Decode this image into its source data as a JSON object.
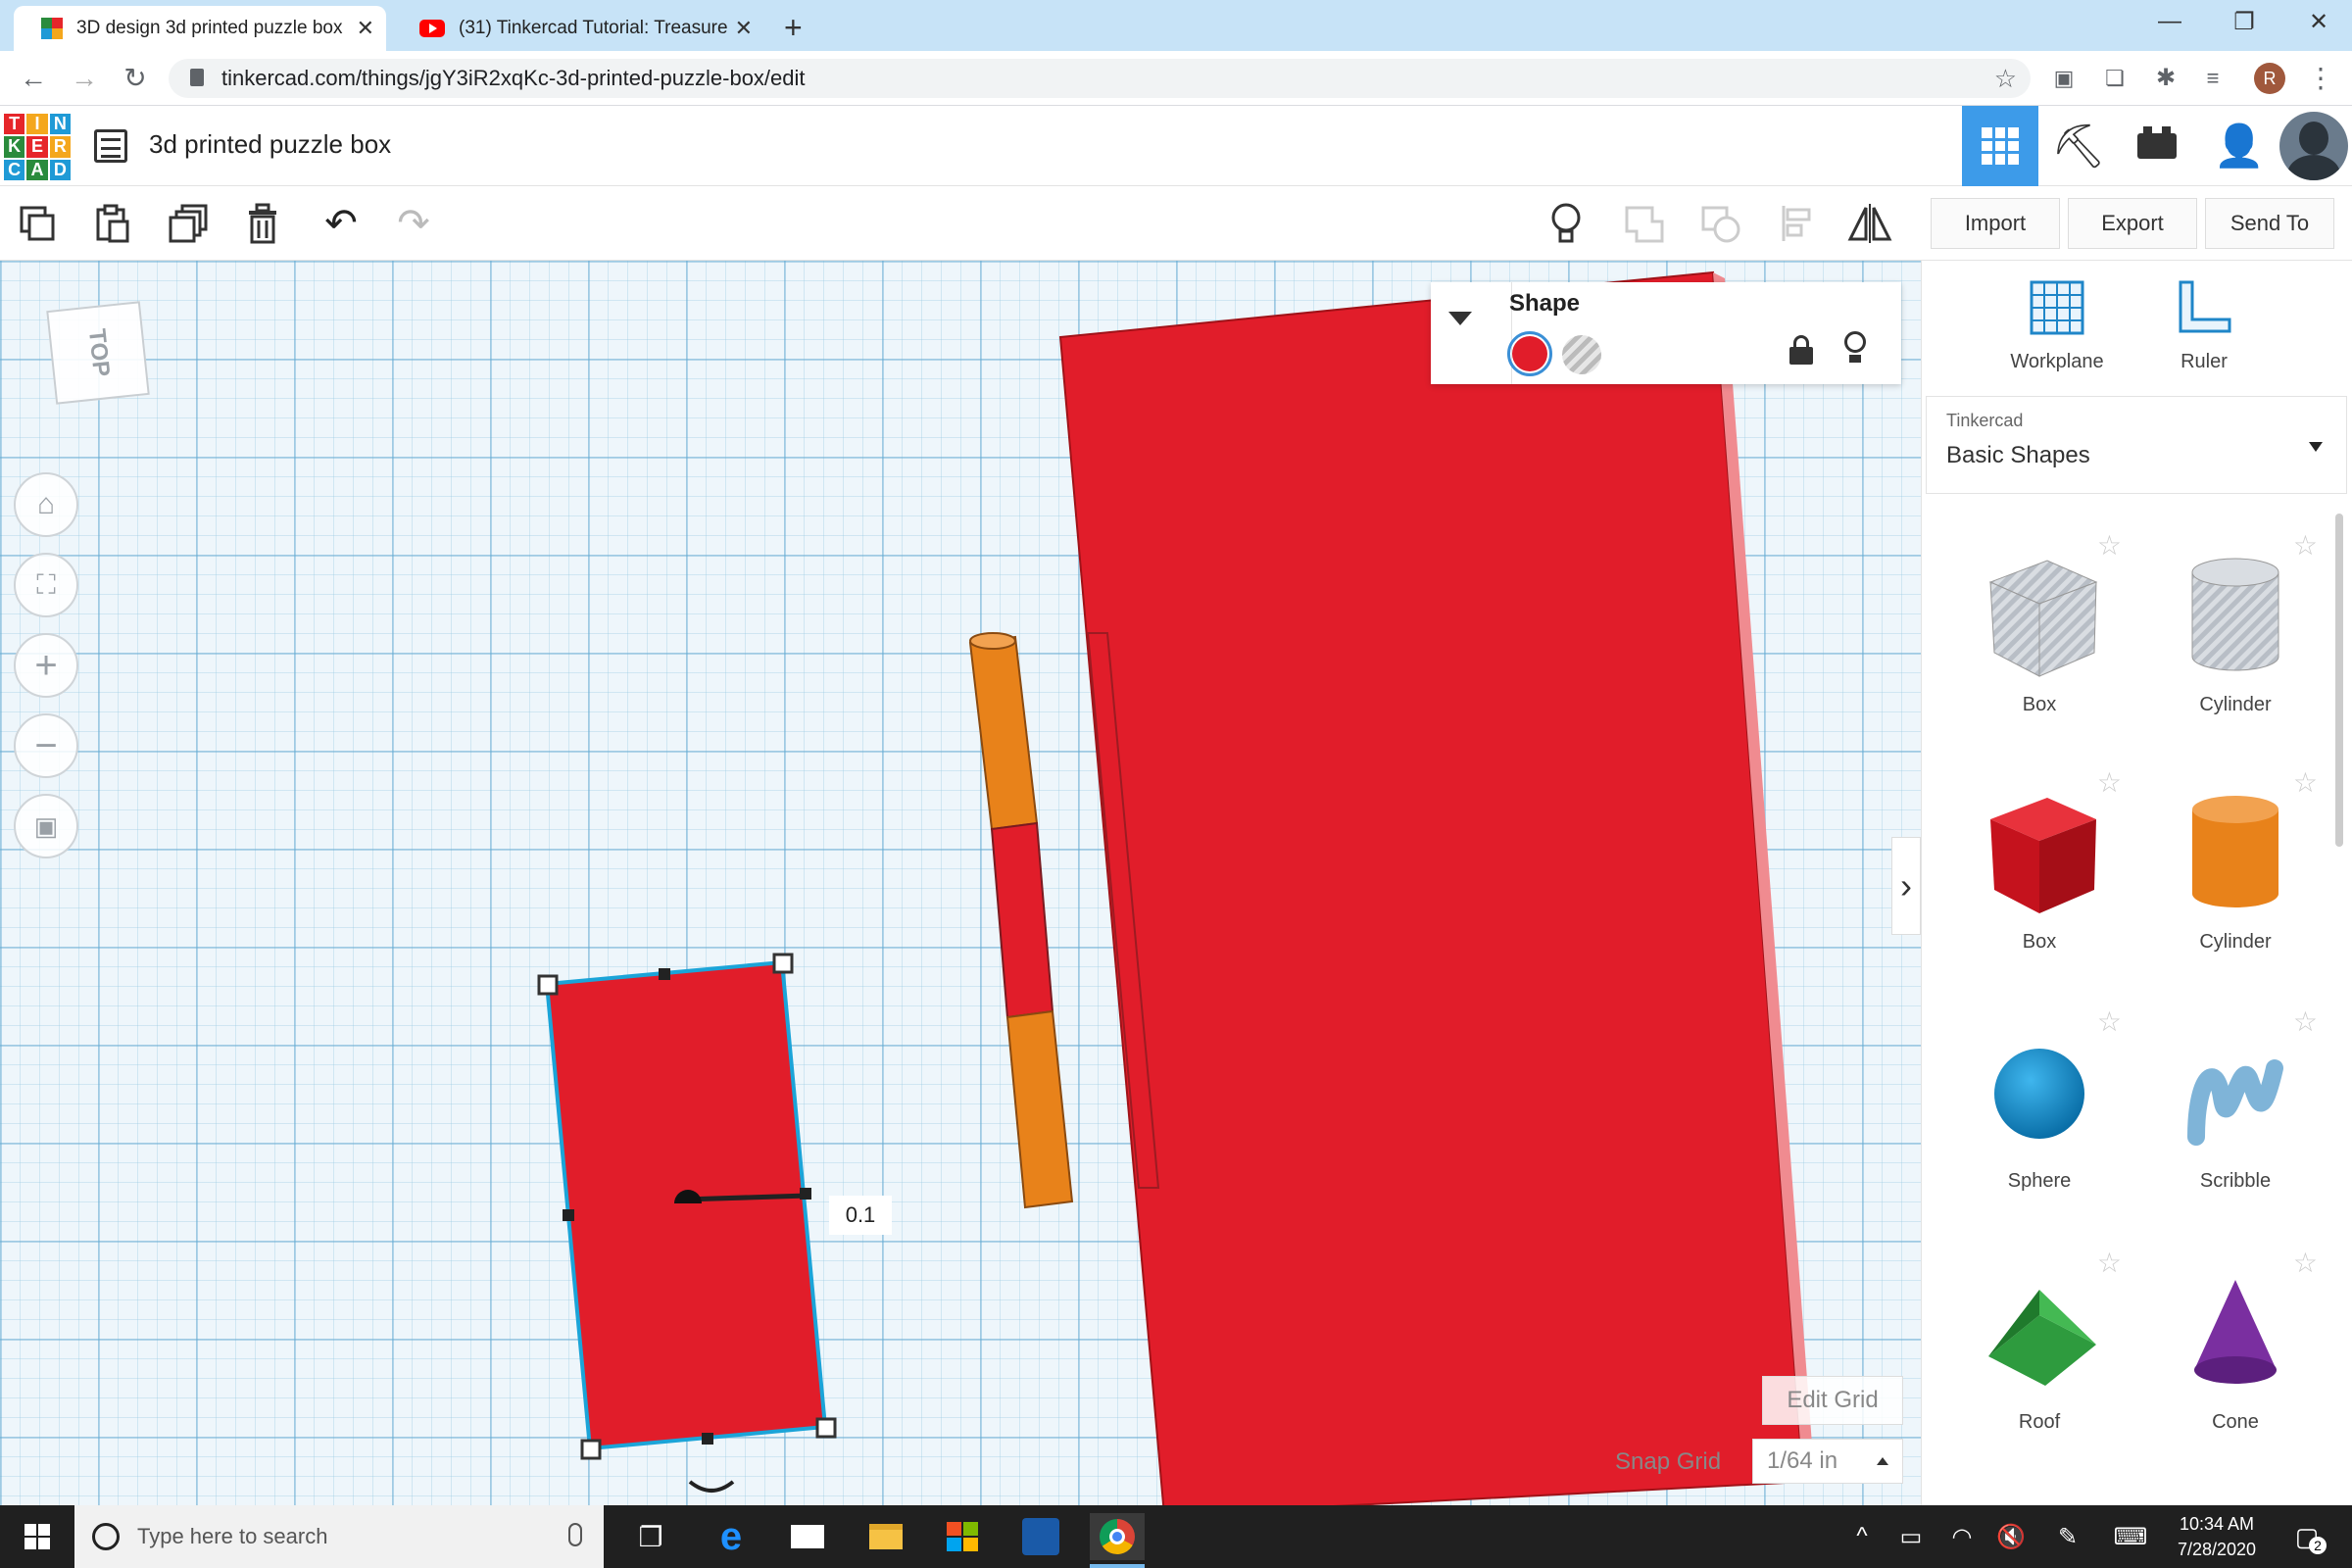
{
  "browser": {
    "tabs": [
      {
        "label": "3D design 3d printed puzzle box"
      },
      {
        "label": "(31) Tinkercad Tutorial: Treasure"
      }
    ],
    "url": "tinkercad.com/things/jgY3iR2xqKc-3d-printed-puzzle-box/edit",
    "avatar_letter": "R"
  },
  "app": {
    "logo": [
      "T",
      "I",
      "N",
      "K",
      "E",
      "R",
      "C",
      "A",
      "D"
    ],
    "logo_colors": [
      "#e6262a",
      "#f4a71d",
      "#1f9ad6",
      "#2a8b3c",
      "#e6262a",
      "#f4a71d",
      "#1f9ad6",
      "#2a8b3c",
      "#1f9ad6"
    ],
    "title": "3d printed puzzle box",
    "import_label": "Import",
    "export_label": "Export",
    "sendto_label": "Send To"
  },
  "workplane": {
    "view_cube_label": "TOP",
    "shape_panel": {
      "title": "Shape",
      "solid_color": "#e11d2a"
    },
    "dimension_value": "0.1",
    "edit_grid_label": "Edit Grid",
    "snap_grid_label": "Snap Grid",
    "snap_grid_value": "1/64 in"
  },
  "right_panel": {
    "workplane_label": "Workplane",
    "ruler_label": "Ruler",
    "library_source": "Tinkercad",
    "library_name": "Basic Shapes",
    "shapes": [
      {
        "label": "Box"
      },
      {
        "label": "Cylinder"
      },
      {
        "label": "Box"
      },
      {
        "label": "Cylinder"
      },
      {
        "label": "Sphere"
      },
      {
        "label": "Scribble"
      },
      {
        "label": "Roof"
      },
      {
        "label": "Cone"
      }
    ]
  },
  "taskbar": {
    "search_placeholder": "Type here to search",
    "time": "10:34 AM",
    "date": "7/28/2020",
    "notification_count": "2"
  }
}
